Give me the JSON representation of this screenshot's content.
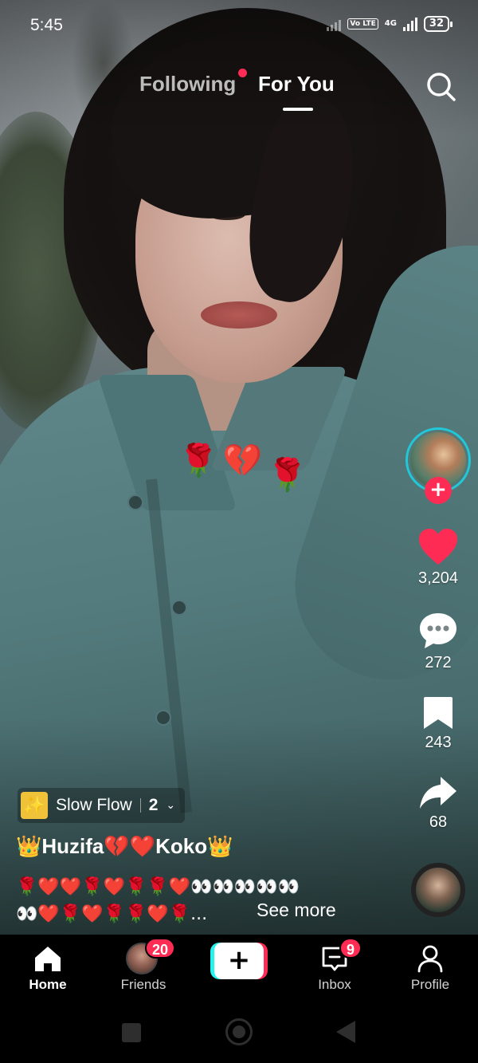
{
  "status_bar": {
    "time": "5:45",
    "network_tag": "Vo LTE",
    "network_type": "4G",
    "battery": "32"
  },
  "top_nav": {
    "tabs": [
      {
        "label": "Following",
        "has_dot": true,
        "active": false
      },
      {
        "label": "For You",
        "active": true
      }
    ],
    "search_icon": "search-icon"
  },
  "video": {
    "overlay_emojis": [
      "🌹",
      "💔",
      "🌹"
    ]
  },
  "right_rail": {
    "avatar_icon": "creator-avatar",
    "follow_label": "+",
    "like_count": "3,204",
    "comment_count": "272",
    "bookmark_count": "243",
    "share_count": "68",
    "colors": {
      "like": "#fe2c55",
      "avatar_ring": "#20c8d8"
    }
  },
  "info": {
    "effect_name": "Slow Flow",
    "effect_count": "2",
    "username": "👑Huzifa💔❤️Koko👑",
    "caption_line1": "🌹❤️❤️🌹❤️🌹🌹❤️👀👀👀👀👀",
    "caption_line2": "👀❤️🌹❤️🌹🌹❤️🌹...",
    "see_more": "See more"
  },
  "tab_bar": {
    "home_label": "Home",
    "friends_label": "Friends",
    "friends_badge": "20",
    "create_label": "+",
    "inbox_label": "Inbox",
    "inbox_badge": "9",
    "profile_label": "Profile",
    "colors": {
      "cyan": "#25f4ee",
      "pink": "#fe2c55"
    }
  }
}
